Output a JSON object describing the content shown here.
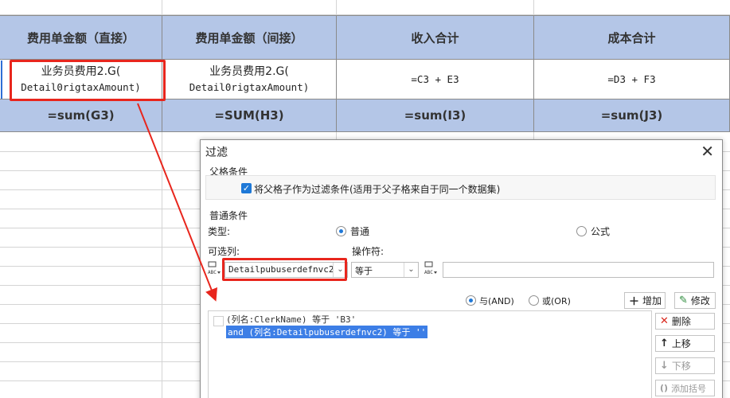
{
  "sheet": {
    "headers": [
      "费用单金额（直接）",
      "费用单金额（间接）",
      "收入合计",
      "成本合计"
    ],
    "data_row": [
      [
        "业务员费用2.G(",
        "Detail0rigtaxAmount)"
      ],
      [
        "业务员费用2.G(",
        "Detail0rigtaxAmount)"
      ],
      [
        "=C3 + E3"
      ],
      [
        "=D3 + F3"
      ]
    ],
    "sum_row": [
      "=sum(G3)",
      "=SUM(H3)",
      "=sum(I3)",
      "=sum(J3)"
    ]
  },
  "dialog": {
    "title": "过滤",
    "parent_section": "父格条件",
    "parent_checkbox_label": "将父格子作为过滤条件(适用于父子格来自于同一个数据集)",
    "parent_checked": true,
    "normal_section": "普通条件",
    "type_label": "类型:",
    "type_normal": "普通",
    "type_formula": "公式",
    "type_selected": "普通",
    "column_label": "可选列:",
    "column_value": "Detailpubuserdefnvc2",
    "operator_label": "操作符:",
    "operator_value": "等于",
    "value_input": "",
    "and_label": "与(AND)",
    "or_label": "或(OR)",
    "logic_selected": "与(AND)",
    "add_label": "增加",
    "modify_label": "修改",
    "conditions": [
      "(列名:ClerkName) 等于 'B3'",
      "and (列名:Detailpubuserdefnvc2) 等于 ''"
    ],
    "delete_label": "删除",
    "up_label": "上移",
    "down_label": "下移",
    "bracket_label": "添加括号"
  },
  "icons": {
    "close": "close-icon",
    "check": "check-icon",
    "abc": "abc-dropdown-icon",
    "add": "plus-icon",
    "modify": "edit-icon",
    "delete": "x-icon",
    "up": "arrow-up-icon",
    "down": "arrow-down-icon",
    "bracket": "parentheses-icon"
  },
  "colors": {
    "header_bg": "#b4c6e7",
    "highlight_red": "#e8261d",
    "accent_blue": "#1e78d7",
    "selection_blue": "#3c7ee6"
  }
}
